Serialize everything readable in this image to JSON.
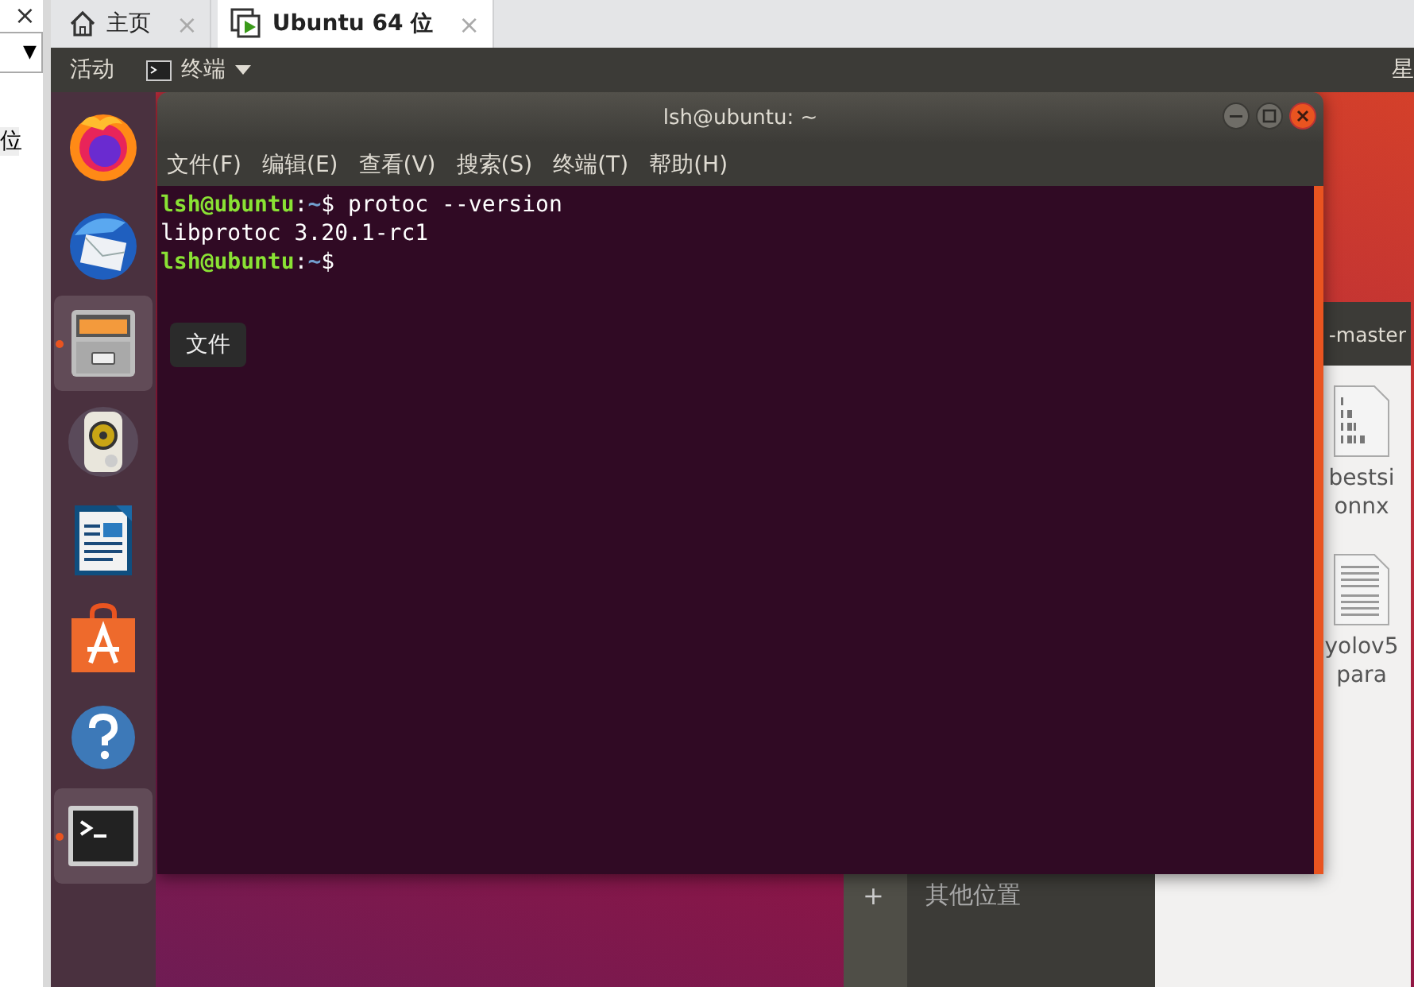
{
  "side_panel": {
    "close": "×",
    "dropdown_arrow": "▼",
    "label": "位"
  },
  "tabs": [
    {
      "kind": "home",
      "label": "主页",
      "selected": false,
      "close": "×"
    },
    {
      "kind": "vm",
      "label": "Ubuntu 64 位",
      "selected": true,
      "close": "×"
    }
  ],
  "top_bar": {
    "activities": "活动",
    "app_menu": "终端",
    "clock": "星"
  },
  "dock": {
    "items": [
      {
        "kind": "browser",
        "highlighted": false,
        "running": false
      },
      {
        "kind": "mail",
        "highlighted": false,
        "running": false
      },
      {
        "kind": "files",
        "highlighted": true,
        "running": true
      },
      {
        "kind": "music",
        "highlighted": false,
        "running": false
      },
      {
        "kind": "writer",
        "highlighted": false,
        "running": false
      },
      {
        "kind": "store",
        "highlighted": false,
        "running": false
      },
      {
        "kind": "help",
        "highlighted": false,
        "running": false
      },
      {
        "kind": "terminal",
        "highlighted": true,
        "running": true
      }
    ],
    "tooltip": "文件"
  },
  "files_window": {
    "title": "-master",
    "sidebar_items": [
      {
        "sign": "+",
        "label": "其他位置"
      }
    ],
    "files": [
      {
        "kind": "binary",
        "name_lines": [
          "bestsi",
          "onnx"
        ]
      },
      {
        "kind": "text",
        "name_lines": [
          "yolov5",
          "para"
        ]
      }
    ]
  },
  "terminal": {
    "title": "lsh@ubuntu: ~",
    "menu": [
      "文件(F)",
      "编辑(E)",
      "查看(V)",
      "搜索(S)",
      "终端(T)",
      "帮助(H)"
    ],
    "lines": [
      {
        "kind": "prompt",
        "user": "lsh@ubuntu",
        "separator": ":",
        "path": "~",
        "symbol": "$",
        "command": "protoc --version"
      },
      {
        "kind": "output",
        "text": "libprotoc 3.20.1-rc1"
      },
      {
        "kind": "prompt",
        "user": "lsh@ubuntu",
        "separator": ":",
        "path": "~",
        "symbol": "$"
      }
    ]
  }
}
